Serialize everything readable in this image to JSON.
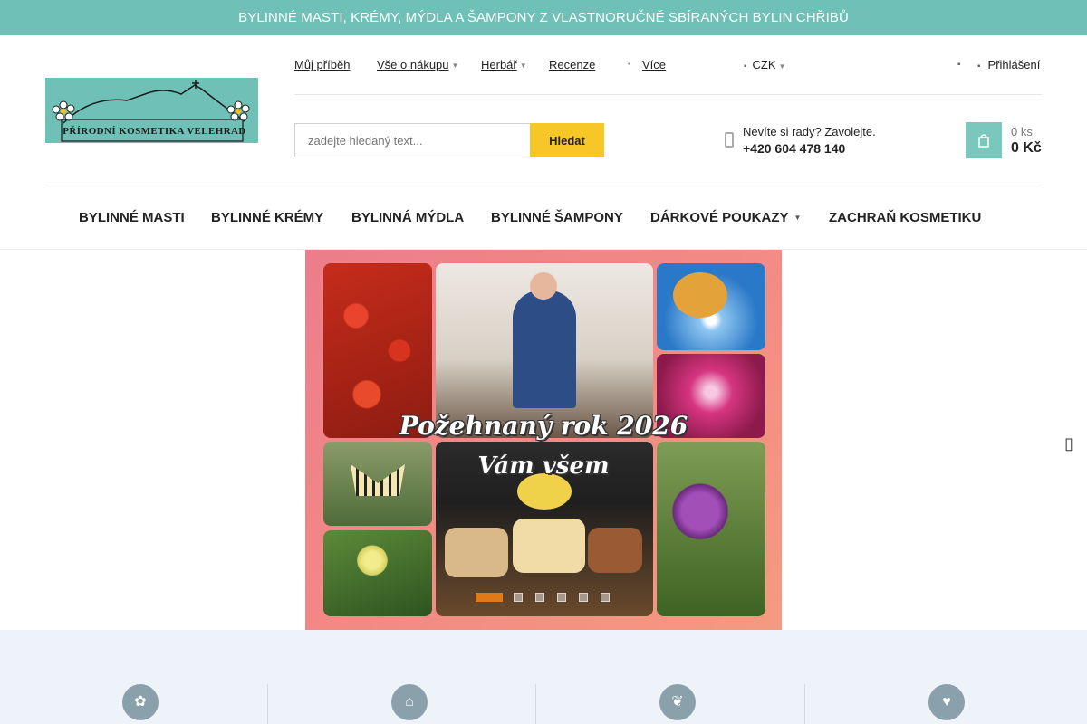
{
  "topbar": {
    "text": "BYLINNÉ MASTI, KRÉMY, MÝDLA A ŠAMPONY Z VLASTNORUČNĚ SBÍRANÝCH BYLIN CHŘIBŮ"
  },
  "logo": {
    "text": "PŘÍRODNÍ KOSMETIKA VELEHRAD",
    "bg_color": "#6fc1b8"
  },
  "topnav": {
    "items": [
      {
        "label": "Můj příběh",
        "has_dropdown": false
      },
      {
        "label": "Vše o nákupu",
        "has_dropdown": true
      },
      {
        "label": "Herbář",
        "has_dropdown": true
      },
      {
        "label": "Recenze",
        "has_dropdown": false
      },
      {
        "label": "Více",
        "has_dropdown": false
      }
    ],
    "currency": "CZK",
    "login": "Přihlášení"
  },
  "search": {
    "placeholder": "zadejte hledaný text...",
    "button": "Hledat"
  },
  "help": {
    "question": "Nevíte si rady? Zavolejte.",
    "phone": "+420 604 478 140"
  },
  "cart": {
    "quantity": "0 ks",
    "price": "0 Kč"
  },
  "mainnav": {
    "items": [
      {
        "label": "BYLINNÉ MASTI"
      },
      {
        "label": "BYLINNÉ KRÉMY"
      },
      {
        "label": "BYLINNÁ MÝDLA"
      },
      {
        "label": "BYLINNÉ ŠAMPONY"
      },
      {
        "label": "DÁRKOVÉ POUKAZY",
        "has_dropdown": true
      },
      {
        "label": "ZACHRAŇ KOSMETIKU"
      }
    ]
  },
  "banner": {
    "title": "Požehnaný rok 2026",
    "subtitle": "Vám všem",
    "slides_count": 6,
    "active_slide": 1
  },
  "features": {
    "icons": [
      "flower-icon",
      "building-icon",
      "herbs-icon",
      "hand-heart-icon"
    ]
  },
  "colors": {
    "accent": "#6fc1b8",
    "button_yellow": "#f6c726",
    "feature_bg": "#eef3fa",
    "feature_icon": "#8aa0ab"
  }
}
